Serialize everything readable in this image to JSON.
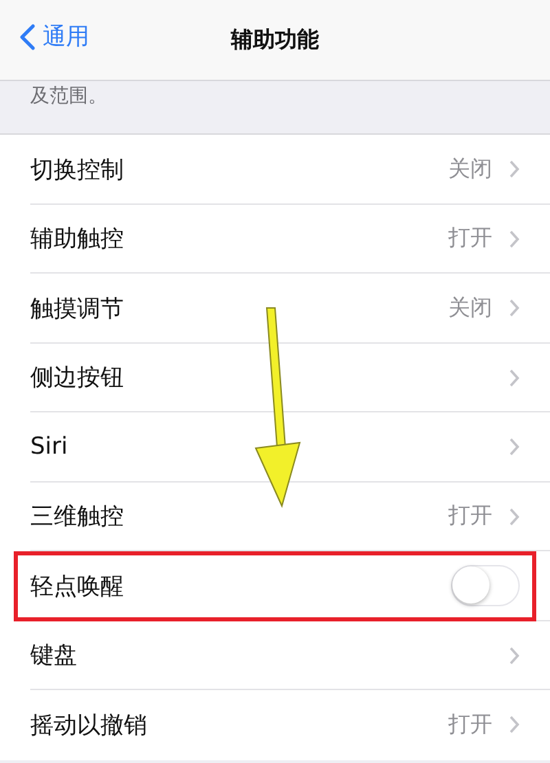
{
  "nav": {
    "back": "通用",
    "title": "辅助功能"
  },
  "section_note": "及范围。",
  "rows": [
    {
      "kind": "value",
      "label": "切换控制",
      "value": "关闭",
      "highlighted": false
    },
    {
      "kind": "value",
      "label": "辅助触控",
      "value": "打开",
      "highlighted": false
    },
    {
      "kind": "value",
      "label": "触摸调节",
      "value": "关闭",
      "highlighted": false
    },
    {
      "kind": "link",
      "label": "侧边按钮",
      "highlighted": false
    },
    {
      "kind": "link",
      "label": "Siri",
      "highlighted": false
    },
    {
      "kind": "value",
      "label": "三维触控",
      "value": "打开",
      "highlighted": false
    },
    {
      "kind": "toggle",
      "label": "轻点唤醒",
      "on": false,
      "highlighted": true
    },
    {
      "kind": "link",
      "label": "键盘",
      "highlighted": false
    },
    {
      "kind": "value",
      "label": "摇动以撤销",
      "value": "打开",
      "highlighted": false
    }
  ]
}
